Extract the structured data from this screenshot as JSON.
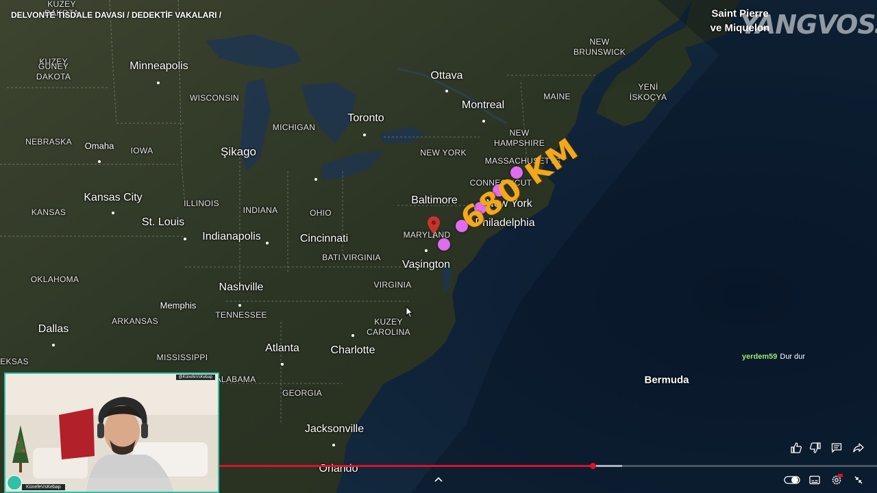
{
  "overlay_title": "DELVONTE TISDALE DAVASI / DEDEKTİF VAKALARI /",
  "watermark": "YANGVOSS",
  "distance_label": "680 KM",
  "map": {
    "city_labels": [
      "Minneapolis",
      "Ottava",
      "Montreal",
      "Toronto",
      "Şikago",
      "Omaha",
      "Kansas City",
      "St. Louis",
      "Indianapolis",
      "Cincinnati",
      "Baltimore",
      "New York",
      "Philadelphia",
      "Vaşington",
      "Nashville",
      "Memphis",
      "Dallas",
      "Atlanta",
      "Charlotte",
      "Jacksonville",
      "Orlando",
      "Bermuda"
    ],
    "state_labels": [
      "KUZEY DAKOTA",
      "GÜNEY DAKOTA",
      "WISCONSIN",
      "MICHIGAN",
      "NEBRASKA",
      "IOWA",
      "ILLINOIS",
      "INDIANA",
      "OHIO",
      "KANSAS",
      "NEW YORK",
      "MAINE",
      "NEW HAMPSHIRE",
      "MASSACHUSETTS",
      "CONNECTICUT",
      "MARYLAND",
      "BATI VIRGINIA",
      "VIRGINIA",
      "KUZEY CAROLINA",
      "OKLAHOMA",
      "ARKANSAS",
      "TENNESSEE",
      "MISSISSIPPI",
      "ALABAMA",
      "GEORGIA",
      "TEKSAS"
    ],
    "region_labels": [
      "Saint Pierre ve Miquelon",
      "NEW BRUNSWICK",
      "YENİ İSKOÇYA"
    ]
  },
  "labels": {
    "kuzey": "KUZEY",
    "dakota_n": "DAKOTA",
    "guney": "GÜNEY",
    "dakota_s": "DAKOTA",
    "minneapolis": "Minneapolis",
    "ottava": "Ottava",
    "montreal": "Montreal",
    "toronto": "Toronto",
    "wisconsin": "WISCONSIN",
    "michigan": "MICHIGAN",
    "sikago": "Şikago",
    "nebraska": "NEBRASKA",
    "omaha": "Omaha",
    "iowa": "IOWA",
    "kansas_city": "Kansas City",
    "illinois": "ILLINOIS",
    "indiana": "INDIANA",
    "ohio": "OHIO",
    "kansas": "KANSAS",
    "st_louis": "St. Louis",
    "indianapolis": "Indianapolis",
    "cincinnati": "Cincinnati",
    "baltimore": "Baltimore",
    "new_york_state": "NEW YORK",
    "maine": "MAINE",
    "new": "NEW",
    "hampshire": "HAMPSHIRE",
    "massachusetts": "MASSACHUSETTS",
    "connecticut": "CONNECTICUT",
    "new_york": "New York",
    "philadelphia": "Philadelphia",
    "maryland": "MARYLAND",
    "bati_virginia": "BATI VIRGINIA",
    "vasington": "Vaşington",
    "virginia": "VIRGINIA",
    "oklahoma": "OKLAHOMA",
    "memphis": "Memphis",
    "nashville": "Nashville",
    "tennessee": "TENNESSEE",
    "arkansas": "ARKANSAS",
    "dallas": "Dallas",
    "kuzey_c": "KUZEY",
    "carolina": "CAROLINA",
    "atlanta": "Atlanta",
    "charlotte": "Charlotte",
    "teksas": "EKSAS",
    "mississippi": "MISSISSIPPI",
    "alabama": "ALABAMA",
    "georgia": "GEORGIA",
    "jacksonville": "Jacksonville",
    "orlando": "Orlando",
    "bermuda": "Bermuda",
    "saint_pierre": "Saint Pierre",
    "ve_miquelon": "ve Miquelon",
    "nb_new": "NEW",
    "brunswick": "BRUNSWICK",
    "yeni": "YENİ",
    "iskocya": "İSKOÇYA"
  },
  "chat": {
    "user": "yerdem59",
    "message": "Dur dur"
  },
  "webcam": {
    "channel_handle": "@KünefeVsKebap",
    "streamer_name": "KünefeVsKebap"
  },
  "player": {
    "progress": 0.5677,
    "buffered": 0.6125,
    "icons": [
      "like-icon",
      "dislike-icon",
      "comment-icon",
      "share-icon",
      "chevron-up-icon",
      "autoplay-toggle-icon",
      "captions-icon",
      "settings-icon",
      "exit-fullscreen-icon"
    ]
  },
  "colors": {
    "marker_dots": "#e06cf0",
    "distance_text": "#f2a81d",
    "progress_played": "#e0102a",
    "webcam_border": "#2fc1a6",
    "pin": "#c8342c"
  }
}
